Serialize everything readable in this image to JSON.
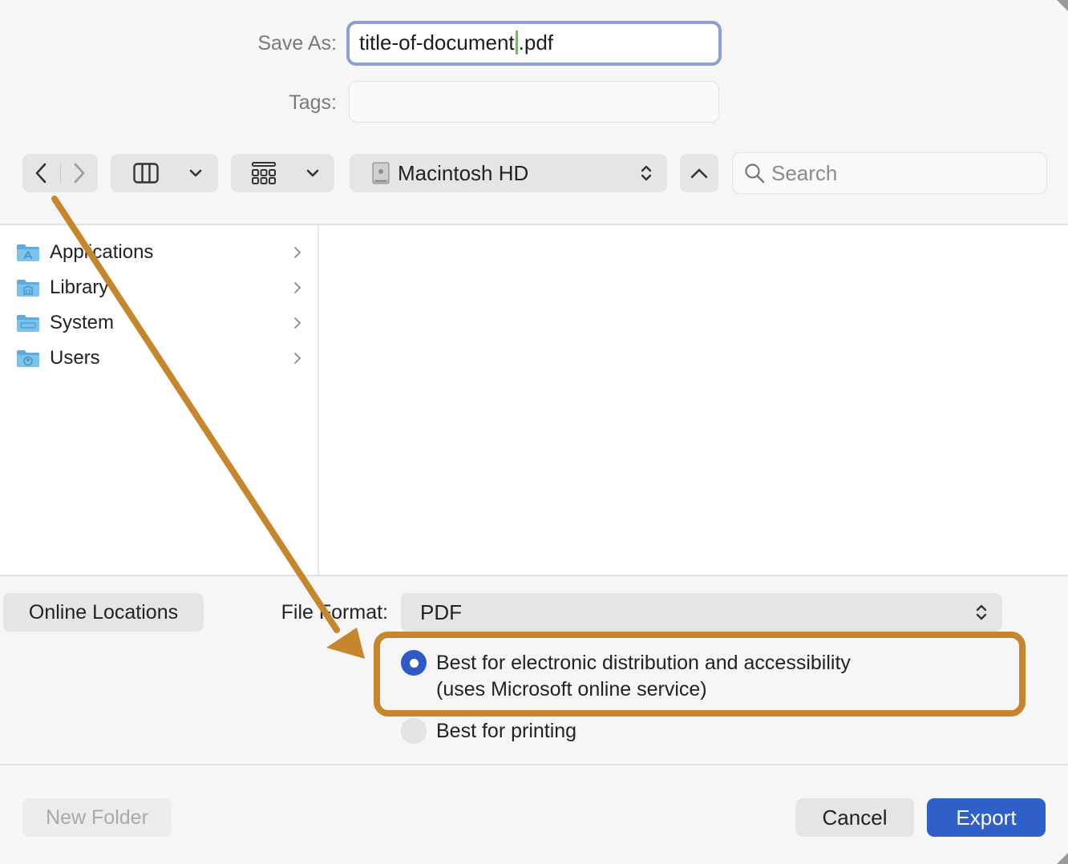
{
  "save_as": {
    "label": "Save As:",
    "name_before_caret": "title-of-document",
    "name_after_caret": ".pdf"
  },
  "tags": {
    "label": "Tags:",
    "value": ""
  },
  "toolbar": {
    "back_icon": "chevron-left-icon",
    "forward_icon": "chevron-right-icon",
    "view_icon": "column-view-icon",
    "group_icon": "icon-grid-icon",
    "location": "Macintosh HD",
    "search_placeholder": "Search"
  },
  "sidebar": {
    "items": [
      {
        "name": "Applications",
        "icon": "applications-folder-icon"
      },
      {
        "name": "Library",
        "icon": "library-folder-icon"
      },
      {
        "name": "System",
        "icon": "system-folder-icon"
      },
      {
        "name": "Users",
        "icon": "users-folder-icon"
      }
    ]
  },
  "bottom": {
    "online_locations": "Online Locations",
    "file_format_label": "File Format:",
    "file_format_value": "PDF",
    "options": [
      {
        "line1": "Best for electronic distribution and accessibility",
        "line2": "(uses Microsoft online service)",
        "selected": true
      },
      {
        "line1": "Best for printing",
        "selected": false
      }
    ],
    "new_folder": "New Folder",
    "cancel": "Cancel",
    "export": "Export"
  },
  "colors": {
    "accent": "#2f5fc8",
    "annotation": "#c8862c",
    "focus_ring": "#8da0d6"
  }
}
